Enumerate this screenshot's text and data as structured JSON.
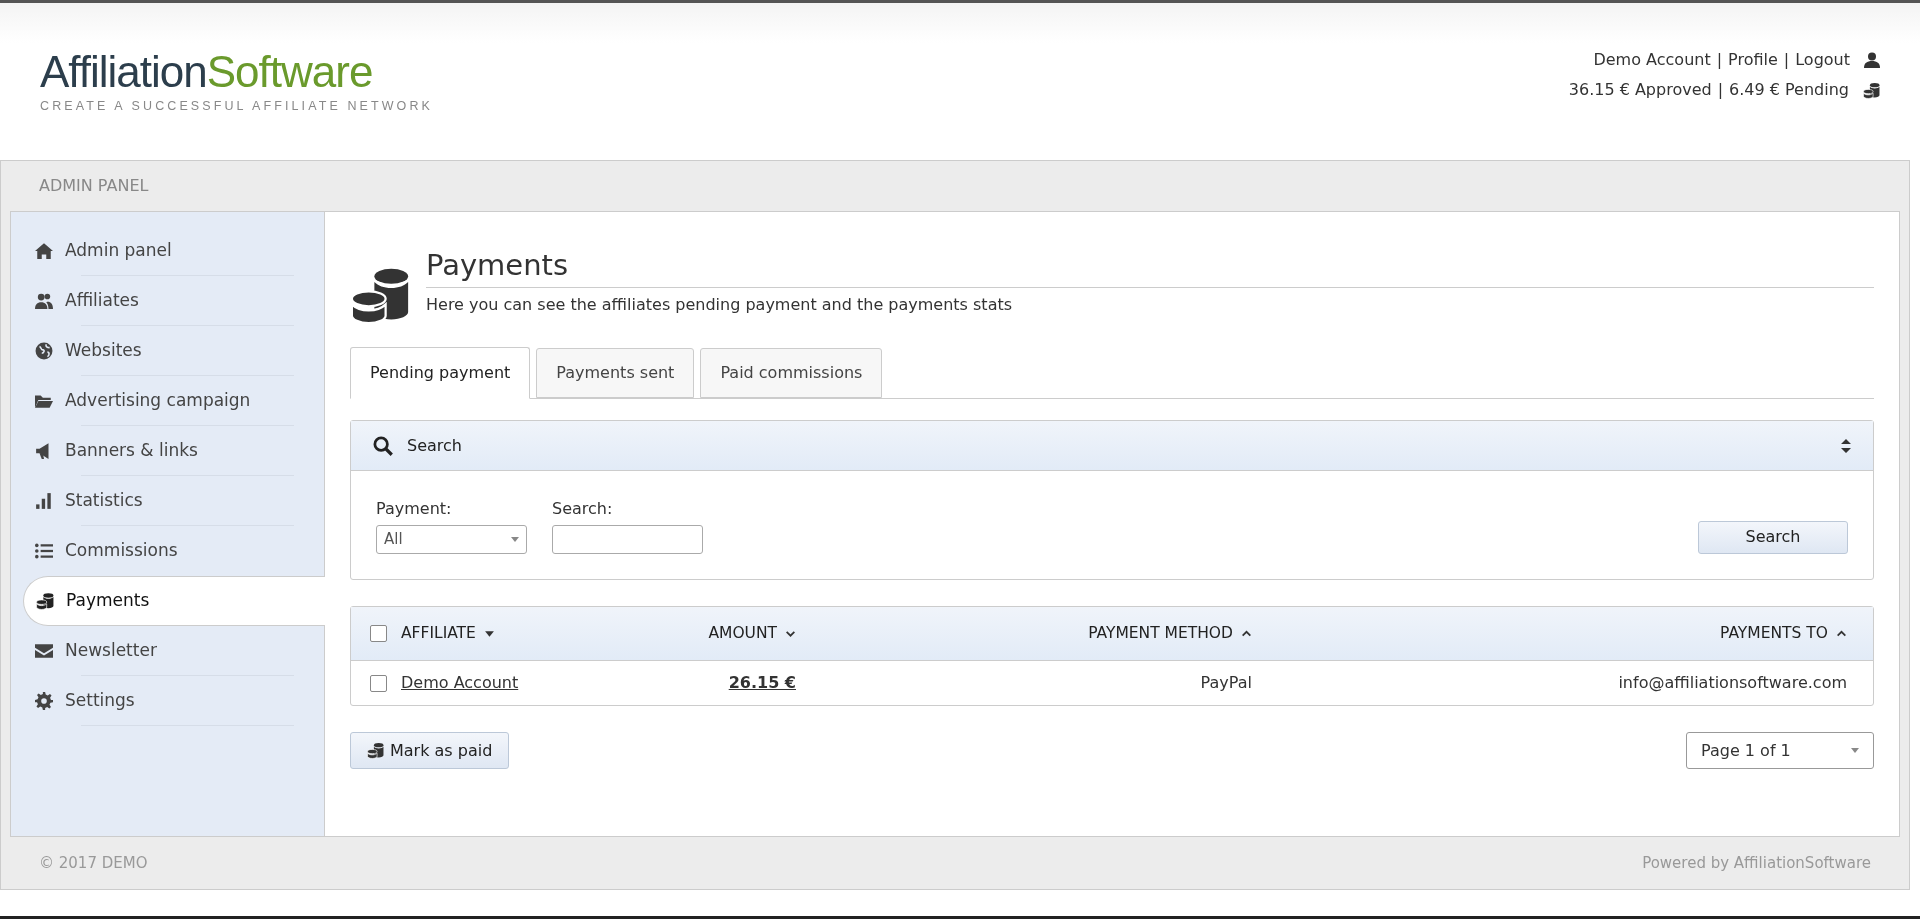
{
  "header": {
    "logo": {
      "part1": "Affiliation",
      "part2": "Software",
      "tagline": "CREATE A SUCCESSFUL AFFILIATE NETWORK"
    },
    "user_links": [
      "Demo Account",
      "Profile",
      "Logout"
    ],
    "separator": "|",
    "balances": [
      "36.15 € Approved",
      "6.49 € Pending"
    ]
  },
  "panel_title": "ADMIN PANEL",
  "sidebar": {
    "items": [
      {
        "label": "Admin panel",
        "kind": "home",
        "selected": false
      },
      {
        "label": "Affiliates",
        "kind": "users",
        "selected": false
      },
      {
        "label": "Websites",
        "kind": "globe",
        "selected": false
      },
      {
        "label": "Advertising campaign",
        "kind": "folder",
        "selected": false
      },
      {
        "label": "Banners & links",
        "kind": "megaphone",
        "selected": false
      },
      {
        "label": "Statistics",
        "kind": "bars",
        "selected": false
      },
      {
        "label": "Commissions",
        "kind": "list",
        "selected": false
      },
      {
        "label": "Payments",
        "kind": "coins",
        "selected": true
      },
      {
        "label": "Newsletter",
        "kind": "envelope",
        "selected": false
      },
      {
        "label": "Settings",
        "kind": "gear",
        "selected": false
      }
    ]
  },
  "page": {
    "title": "Payments",
    "subtitle": "Here you can see the affiliates pending payment and the payments stats"
  },
  "tabs": [
    {
      "label": "Pending payment",
      "selected": true
    },
    {
      "label": "Payments sent",
      "selected": false
    },
    {
      "label": "Paid commissions",
      "selected": false
    }
  ],
  "search_panel": {
    "title": "Search",
    "payment_label": "Payment:",
    "payment_value": "All",
    "search_label": "Search:",
    "button": "Search"
  },
  "table": {
    "select_all_checked": false,
    "columns": [
      {
        "label": "AFFILIATE",
        "kind": "caret-down"
      },
      {
        "label": "AMOUNT",
        "kind": "chevron-down"
      },
      {
        "label": "PAYMENT METHOD",
        "kind": "chevron-up"
      },
      {
        "label": "PAYMENTS TO",
        "kind": "chevron-up"
      }
    ],
    "rows": [
      {
        "checked": false,
        "affiliate": "Demo Account",
        "amount": "26.15 €",
        "method": "PayPal",
        "payments_to": "info@affiliationsoftware.com"
      }
    ]
  },
  "mark_paid_button": "Mark as paid",
  "pagination": "Page 1 of 1",
  "footer": {
    "left": "© 2017 DEMO",
    "right": "Powered by AffiliationSoftware"
  }
}
